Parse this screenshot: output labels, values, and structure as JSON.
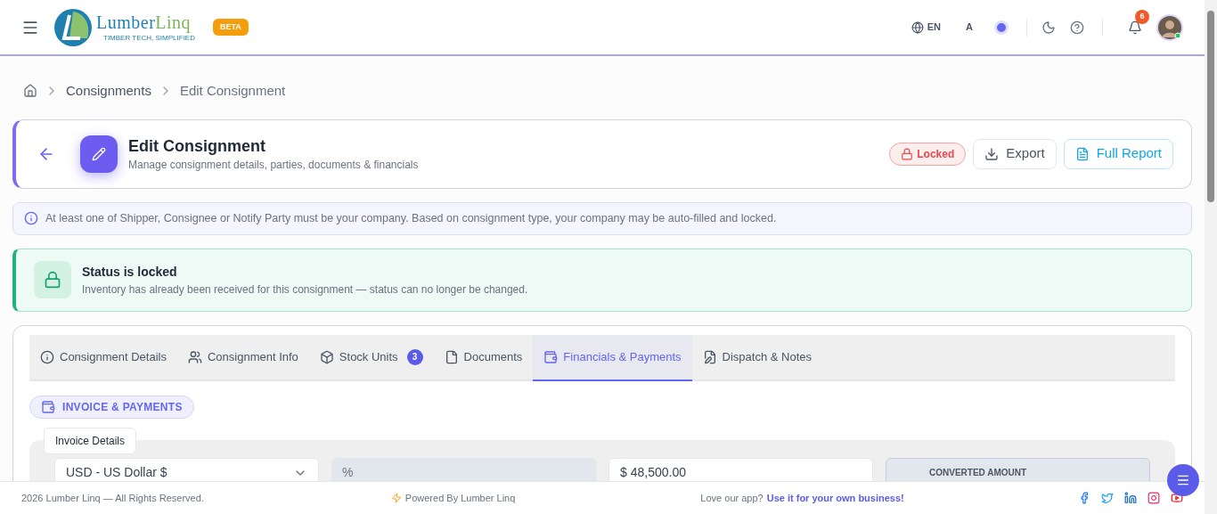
{
  "header": {
    "logo_word_1": "Lumber",
    "logo_word_2": "Linq",
    "tagline": "TIMBER TECH, SIMPLIFIED",
    "beta_badge": "BETA",
    "language": "EN",
    "font_size_label": "A",
    "notifications_count": "6"
  },
  "breadcrumb": [
    "Consignments",
    "Edit Consignment"
  ],
  "page": {
    "title": "Edit Consignment",
    "subtitle": "Manage consignment details, parties, documents & financials",
    "status_badge": "Locked",
    "buttons": [
      {
        "label": "Export",
        "kind": "export"
      },
      {
        "label": "Full Report",
        "kind": "report"
      }
    ]
  },
  "info_note": "At least one of Shipper, Consignee or Notify Party must be your company. Based on consignment type, your company may be auto-filled and locked.",
  "status_alert": {
    "title": "Status is locked",
    "message": "Inventory has already been received for this consignment — status can no longer be changed."
  },
  "tabs": [
    {
      "label": "Consignment Details",
      "kind": "info",
      "selected": false
    },
    {
      "label": "Consignment Info",
      "kind": "users",
      "selected": false
    },
    {
      "label": "Stock Units",
      "kind": "box",
      "selected": false,
      "badge": "3"
    },
    {
      "label": "Documents",
      "kind": "file",
      "selected": false
    },
    {
      "label": "Financials & Payments",
      "kind": "wallet",
      "selected": true
    },
    {
      "label": "Dispatch & Notes",
      "kind": "edit",
      "selected": false
    }
  ],
  "section_chip": "INVOICE & PAYMENTS",
  "invoice_group": {
    "legend": "Invoice Details",
    "currency": "USD - US Dollar $",
    "rate_prefix": "%",
    "amount": "$ 48,500.00",
    "converted_label": "CONVERTED AMOUNT"
  },
  "footer": {
    "copyright": "2026 Lumber Linq — All Rights Reserved.",
    "powered_by": "Powered By Lumber Linq",
    "promo_text": "Love our app?",
    "promo_link": "Use it for your own business!"
  }
}
